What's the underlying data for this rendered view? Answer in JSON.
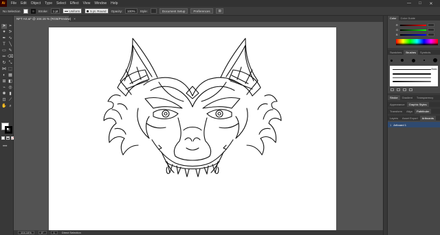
{
  "menubar": {
    "logo": "Ai",
    "items": [
      "File",
      "Edit",
      "Object",
      "Type",
      "Select",
      "Effect",
      "View",
      "Window",
      "Help"
    ],
    "window_controls": [
      "—",
      "□",
      "✕"
    ]
  },
  "controlbar": {
    "selection": "No Selection",
    "stroke_label": "Stroke:",
    "stroke_weight": "1 pt",
    "profile": "Uniform",
    "brush": "5 pt. Round",
    "opacity_label": "Opacity:",
    "opacity_value": "100%",
    "style_label": "Style:",
    "document_setup": "Document Setup",
    "preferences": "Preferences"
  },
  "document": {
    "tab_title": "NFT Art.ai* @ 104.16 % (RGB/Preview)",
    "close": "×"
  },
  "statusbar": {
    "zoom": "104.16%",
    "rotation": "0°",
    "artboard": "1",
    "tool": "Direct Selection"
  },
  "color_panel": {
    "tabs": [
      "Color",
      "Color Guide"
    ],
    "channels": [
      "R",
      "G",
      "B"
    ],
    "colors": {
      "R": "#e05050",
      "G": "#50c050",
      "B": "#5080e0"
    }
  },
  "brush_panel": {
    "tabs": [
      "Swatches",
      "Brushes",
      "Symbols"
    ],
    "brush_name": "Basic"
  },
  "stroke_panel": {
    "tabs": [
      "Stroke",
      "Gradient",
      "Transparency"
    ]
  },
  "appearance_panel": {
    "tabs": [
      "Appearance",
      "Graphic Styles"
    ]
  },
  "transform_panel": {
    "tabs": [
      "Transform",
      "Align",
      "Pathfinder"
    ]
  },
  "layers_panel": {
    "tabs": [
      "Layers",
      "Asset Export",
      "Artboards"
    ],
    "rows": [
      {
        "num": "1",
        "name": "Artboard 1"
      }
    ]
  }
}
